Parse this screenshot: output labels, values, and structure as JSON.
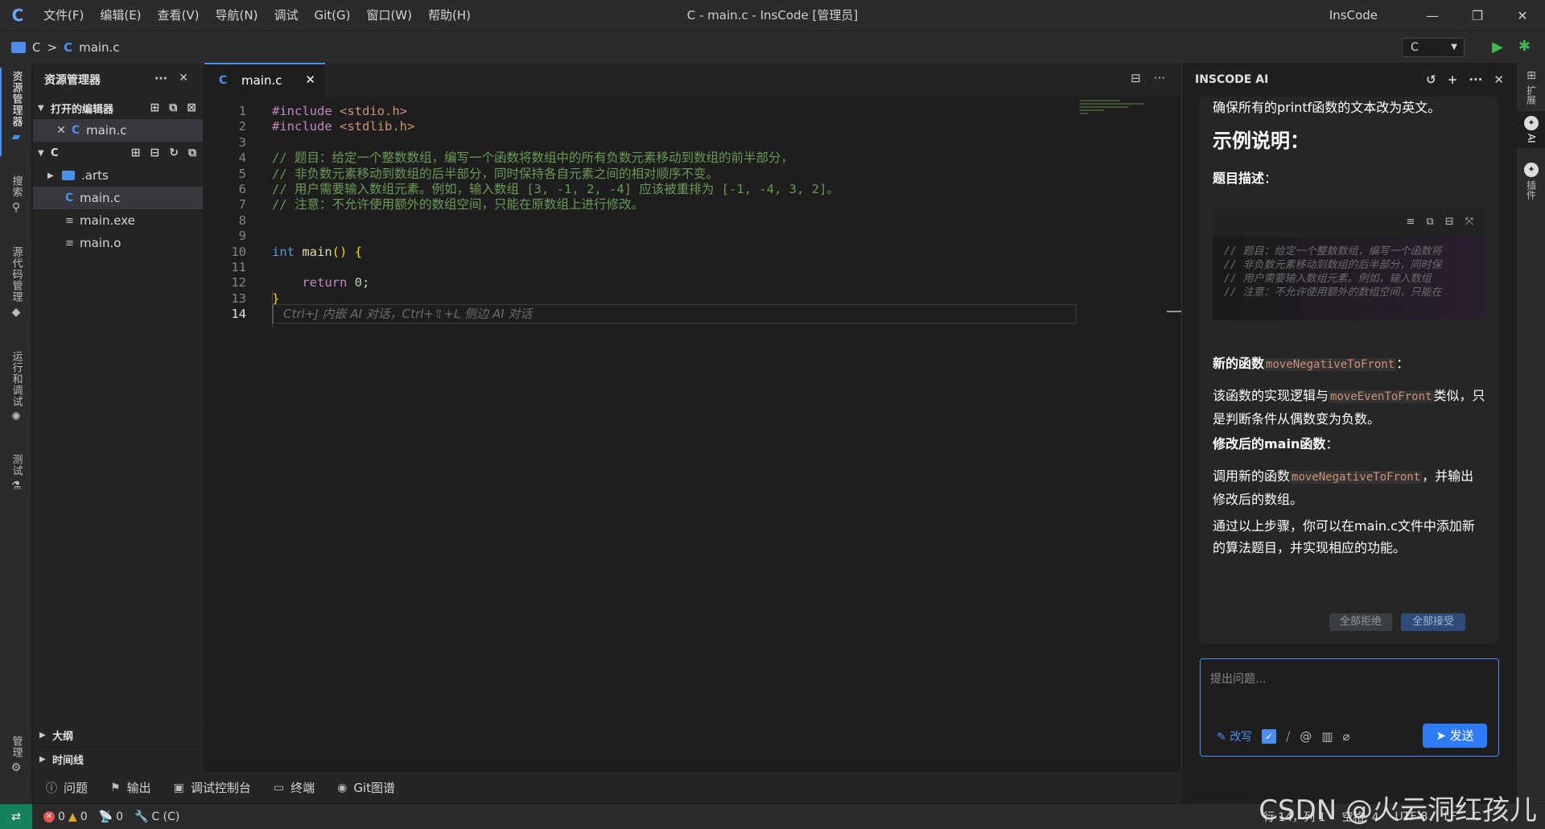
{
  "titlebar": {
    "menus": [
      "文件(F)",
      "编辑(E)",
      "查看(V)",
      "导航(N)",
      "调试",
      "Git(G)",
      "窗口(W)",
      "帮助(H)"
    ],
    "title": "C - main.c - InsCode [管理员]",
    "brand": "InsCode",
    "logo": "C",
    "minimize": "—",
    "maximize": "❐",
    "close": "✕"
  },
  "breadcrumb": {
    "folder": "C",
    "sep": ">",
    "file_icon": "C",
    "file": "main.c",
    "language": "C"
  },
  "activitybar": {
    "explorer": "资源管理器",
    "search": "搜索",
    "scm": "源代码管理",
    "debug": "运行和调试",
    "test": "测试",
    "manage": "管理"
  },
  "explorer": {
    "title": "资源管理器",
    "open_editors": "打开的编辑器",
    "open_file": "main.c",
    "root": "C",
    "items": [
      {
        "label": ".arts",
        "type": "folder"
      },
      {
        "label": "main.c",
        "type": "c"
      },
      {
        "label": "main.exe",
        "type": "file"
      },
      {
        "label": "main.o",
        "type": "file"
      }
    ],
    "outline": "大纲",
    "timeline": "时间线"
  },
  "editor": {
    "tab": "main.c",
    "lines": [
      {
        "n": "1",
        "html": "<span class='kw-inc'>#include</span> <span class='str'>&lt;stdio.h&gt;</span>"
      },
      {
        "n": "2",
        "html": "<span class='kw-inc'>#include</span> <span class='str'>&lt;stdlib.h&gt;</span>"
      },
      {
        "n": "3",
        "html": ""
      },
      {
        "n": "4",
        "html": "<span class='cm'>// 题目：给定一个整数数组，编写一个函数将数组中的所有负数元素移动到数组的前半部分，</span>"
      },
      {
        "n": "5",
        "html": "<span class='cm'>// 非负数元素移动到数组的后半部分，同时保持各自元素之间的相对顺序不变。</span>"
      },
      {
        "n": "6",
        "html": "<span class='cm'>// 用户需要输入数组元素。例如，输入数组 [3, -1, 2, -4] 应该被重排为 [-1, -4, 3, 2]。</span>"
      },
      {
        "n": "7",
        "html": "<span class='cm'>// 注意：不允许使用额外的数组空间，只能在原数组上进行修改。</span>"
      },
      {
        "n": "8",
        "html": ""
      },
      {
        "n": "9",
        "html": ""
      },
      {
        "n": "10",
        "html": "<span class='kw'>int</span> <span class='fn'>main</span><span class='brace'>()</span> <span class='brace'>{</span>"
      },
      {
        "n": "11",
        "html": ""
      },
      {
        "n": "12",
        "html": "    <span class='kw-inc'>return</span> <span class='num'>0</span>;"
      },
      {
        "n": "13",
        "html": "<span class='brace'>}</span>"
      },
      {
        "n": "14",
        "html": ""
      }
    ],
    "ghost_hint": "Ctrl+J 内嵌 AI 对话，Ctrl+⇧+L 侧边 AI 对话"
  },
  "ai": {
    "title": "INSCODE AI",
    "p1": "确保所有的printf函数的文本改为英文。",
    "h2": "示例说明：",
    "h4_desc": "题目描述",
    "colon": "：",
    "code_lines": [
      "// 题目：给定一个整数数组，编写一个函数将",
      "// 非负数元素移动到数组的后半部分，同时保",
      "// 用户需要输入数组元素。例如，输入数组",
      "// 注意：不允许使用额外的数组空间，只能在"
    ],
    "h4_newfn": "新的函数",
    "fn_new": "moveNegativeToFront",
    "p_impl_a": "该函数的实现逻辑与",
    "fn_even": "moveEvenToFront",
    "p_impl_b": "类似，只是判断条件从偶数变为负数。",
    "h4_main": "修改后的main函数",
    "p_call_a": "调用新的函数",
    "p_call_b": "，并输出修改后的数组。",
    "p_final": "通过以上步骤，你可以在main.c文件中添加新的算法题目，并实现相应的功能。",
    "reject_all": "全部拒绝",
    "accept_all": "全部接受",
    "input_placeholder": "提出问题...",
    "rewrite": "改写",
    "send": "发送"
  },
  "rightbar": {
    "ext": "扩展",
    "ai": "AI",
    "plugin": "插件"
  },
  "panel": {
    "tabs": [
      "问题",
      "输出",
      "调试控制台",
      "终端",
      "Git图谱"
    ]
  },
  "status": {
    "errors": "0",
    "warnings": "0",
    "ports": "0",
    "lang": "C (C)",
    "pos": "行 14，列 1",
    "spaces": "空格: 4",
    "encoding": "UTF-8",
    "eol": "LF",
    "mode": "C"
  },
  "watermark": "CSDN @火云洞红孩儿",
  "colors": {
    "accent": "#4d8ef0",
    "run": "#3fb950"
  }
}
